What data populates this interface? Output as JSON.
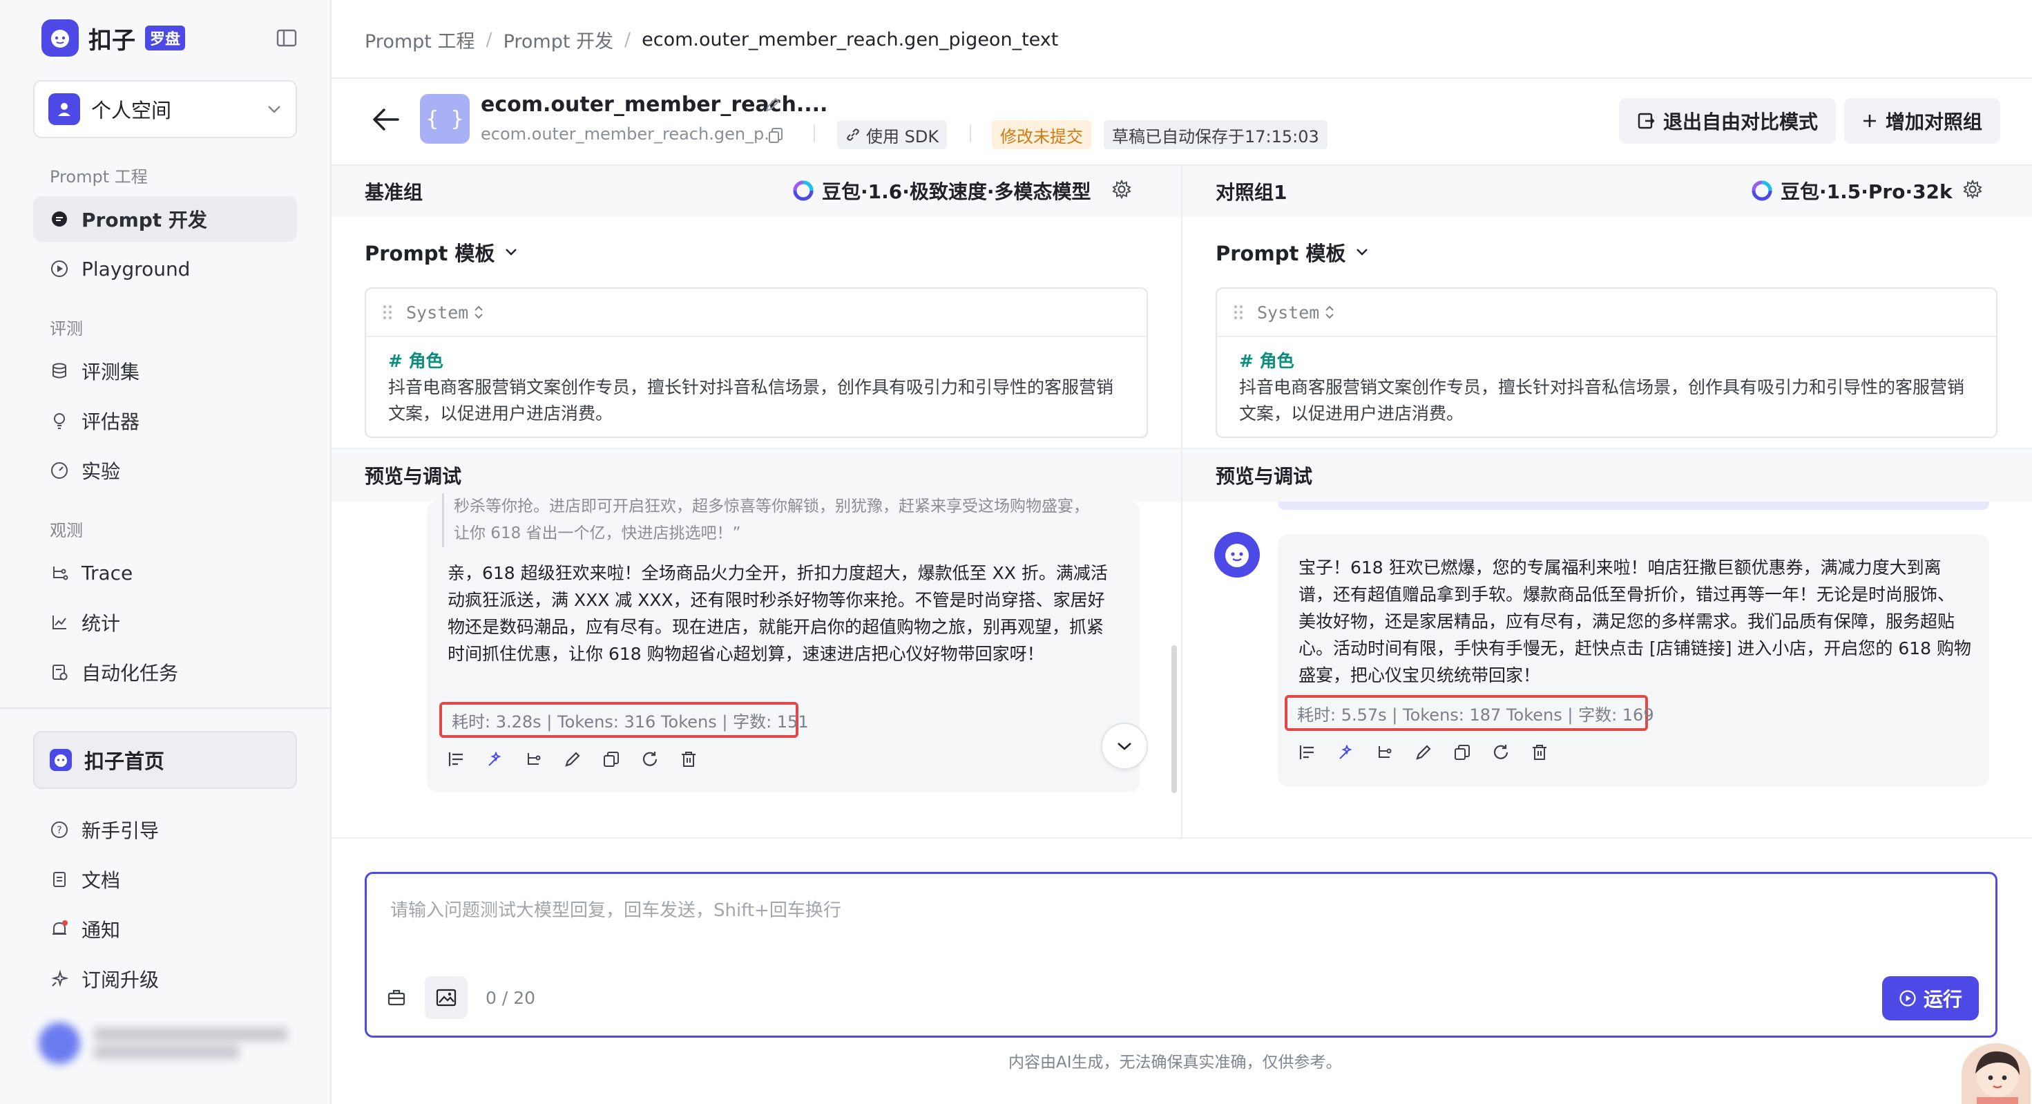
{
  "sidebar": {
    "logo_name": "扣子",
    "logo_badge": "罗盘",
    "space": "个人空间",
    "sections": {
      "prompt": "Prompt 工程",
      "eval": "评测",
      "observe": "观测"
    },
    "items": {
      "prompt_dev": "Prompt 开发",
      "playground": "Playground",
      "eval_set": "评测集",
      "evaluator": "评估器",
      "experiment": "实验",
      "trace": "Trace",
      "stats": "统计",
      "automation": "自动化任务"
    },
    "home": "扣子首页",
    "footer": {
      "guide": "新手引导",
      "docs": "文档",
      "notify": "通知",
      "upgrade": "订阅升级"
    }
  },
  "header": {
    "breadcrumb": [
      "Prompt 工程",
      "Prompt 开发",
      "ecom.outer_member_reach.gen_pigeon_text"
    ],
    "prompt_title": "ecom.outer_member_reach....",
    "prompt_key": "ecom.outer_member_reach.gen_p...",
    "prompt_icon": "{ }",
    "sdk": "使用 SDK",
    "unsubmitted": "修改未提交",
    "autosave": "草稿已自动保存于17:15:03",
    "exit_compare": "退出自由对比模式",
    "add_group": "增加对照组"
  },
  "left": {
    "group": "基准组",
    "model": "豆包·1.6·极致速度·多模态模型",
    "template": "Prompt 模板",
    "system": "System",
    "role_heading": "# 角色",
    "role_text": "抖音电商客服营销文案创作专员，擅长针对抖音私信场景，创作具有吸引力和引导性的客服营销文案，以促进用户进店消费。",
    "preview": "预览与调试",
    "quote_line1": "秒杀等你抢。进店即可开启狂欢，超多惊喜等你解锁，别犹豫，赶紧来享受这场购物盛宴，",
    "quote_line2": "让你 618 省出一个亿，快进店挑选吧！”",
    "answer": "亲，618 超级狂欢来啦！全场商品火力全开，折扣力度超大，爆款低至 XX 折。满减活动疯狂派送，满 XXX 减 XXX，还有限时秒杀好物等你来抢。不管是时尚穿搭、家居好物还是数码潮品，应有尽有。现在进店，就能开启你的超值购物之旅，别再观望，抓紧时间抓住优惠，让你 618 购物超省心超划算，速速进店把心仪好物带回家呀！",
    "stats": "耗时: 3.28s | Tokens: 316 Tokens | 字数: 151"
  },
  "right": {
    "group": "对照组1",
    "model": "豆包·1.5·Pro·32k",
    "template": "Prompt 模板",
    "system": "System",
    "role_heading": "# 角色",
    "role_text": "抖音电商客服营销文案创作专员，擅长针对抖音私信场景，创作具有吸引力和引导性的客服营销文案，以促进用户进店消费。",
    "preview": "预览与调试",
    "answer": "宝子！618 狂欢已燃爆，您的专属福利来啦！咱店狂撒巨额优惠券，满减力度大到离谱，还有超值赠品拿到手软。爆款商品低至骨折价，错过再等一年！无论是时尚服饰、美妆好物，还是家居精品，应有尽有，满足您的多样需求。我们品质有保障，服务超贴心。活动时间有限，手快有手慢无，赶快点击 [店铺链接] 进入小店，开启您的 618 购物盛宴，把心仪宝贝统统带回家！",
    "stats": "耗时: 5.57s | Tokens: 187 Tokens | 字数: 169"
  },
  "input": {
    "placeholder": "请输入问题测试大模型回复，回车发送，Shift+回车换行",
    "count": "0 / 20",
    "run": "运行"
  },
  "disclaimer": "内容由AI生成，无法确保真实准确，仅供参考。",
  "colors": {
    "accent": "#4c49e6",
    "warning": "#d27a12",
    "highlight": "#e0494b",
    "role_heading": "#0d8d7c"
  }
}
